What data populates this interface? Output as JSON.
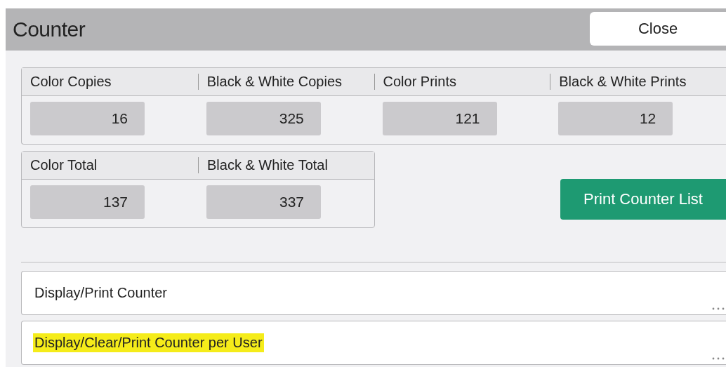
{
  "window": {
    "title": "Counter"
  },
  "close_button": "Close",
  "counter_groups": [
    {
      "cells": [
        {
          "label": "Color Copies",
          "value": "16"
        },
        {
          "label": "Black & White Copies",
          "value": "325"
        },
        {
          "label": "Color Prints",
          "value": "121"
        },
        {
          "label": "Black & White Prints",
          "value": "12"
        }
      ]
    },
    {
      "cells": [
        {
          "label": "Color Total",
          "value": "137"
        },
        {
          "label": "Black & White Total",
          "value": "337"
        }
      ]
    }
  ],
  "print_button": "Print Counter List",
  "menu_items": [
    {
      "label": "Display/Print Counter",
      "highlighted": false
    },
    {
      "label": "Display/Clear/Print Counter per User",
      "highlighted": true
    }
  ]
}
